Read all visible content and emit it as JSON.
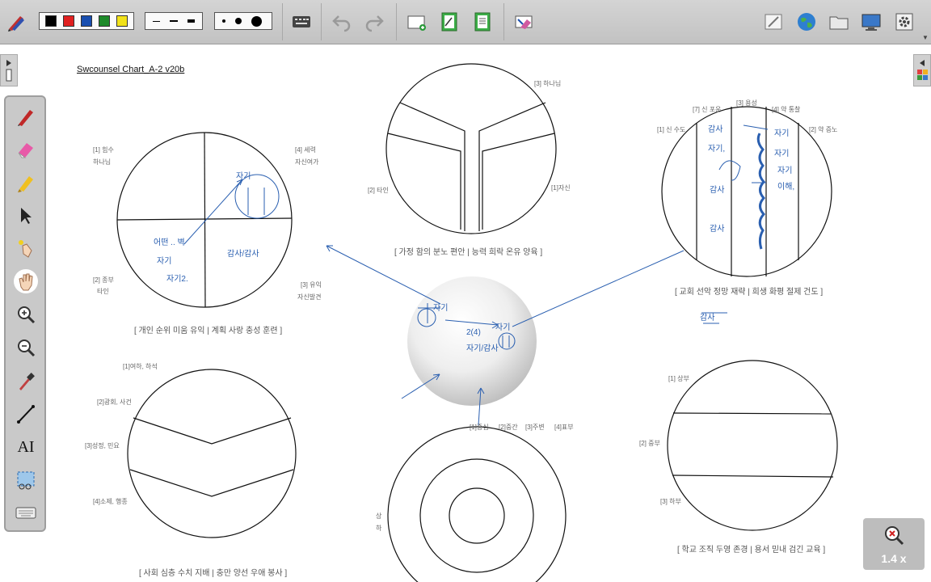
{
  "document": {
    "title": "Swcounsel Chart_A-2 v20b"
  },
  "toolbar": {
    "colors": [
      "#000000",
      "#e02020",
      "#1a4fb0",
      "#1e8a2a",
      "#f2e21a"
    ],
    "icons": [
      "pen-set-icon",
      "keyboard-icon",
      "undo-icon",
      "redo-icon",
      "add-page-icon",
      "page-edit-icon",
      "page-list-icon",
      "eraser-clear-icon",
      "annotate-icon",
      "globe-icon",
      "folder-icon",
      "display-icon",
      "settings-icon"
    ]
  },
  "palette": {
    "tools": [
      "pen-icon",
      "eraser-icon",
      "highlighter-icon",
      "select-arrow-icon",
      "pointer-hand-icon",
      "pan-hand-icon",
      "zoom-in-icon",
      "zoom-out-icon",
      "color-picker-icon",
      "line-tool-icon",
      "text-tool-icon",
      "screen-capture-icon",
      "keyboard-icon"
    ],
    "text_tool_label": "AI"
  },
  "zoom": {
    "level": "1.4 x"
  },
  "diagrams": {
    "quadrant": {
      "labels": [
        "[1] 힘수",
        "하나님",
        "[4] 세력",
        "자신여가",
        "[2] 종부",
        "타인",
        "[3] 유익",
        "자신발견"
      ],
      "caption": "[ 개인 순위 미움 유익 | 계획 사랑 충성 훈련 ]"
    },
    "trisect": {
      "labels": [
        "[3] 하나님",
        "[2] 타인",
        "[1]자신"
      ],
      "caption": "[ 가정 함의 분노 편안 | 능력 희락 온유 양육 ]"
    },
    "church": {
      "labels": [
        "[7] 신 포운",
        "[3] 용성",
        "[4] 약 통찰",
        "[1] 신 수도",
        "[2] 약 증노"
      ],
      "caption": "[ 교회 선악 정망 재략 | 희생 화평 절제 건도 ]"
    },
    "chevron": {
      "labels": [
        "[1]여하, 하석",
        "[2]광회, 사건",
        "[3]성정, 민요",
        "[4]소제, 행종"
      ],
      "caption": "[ 사회 심층 수치 지배 | 충만 양선 우애 봉사 ]"
    },
    "concentric": {
      "labels": [
        "[1]중심",
        "[2]중간",
        "[3]주변",
        "[4]표부",
        "상",
        "하"
      ]
    },
    "bands": {
      "labels": [
        "[1] 상부",
        "[2] 중부",
        "[3] 하부"
      ],
      "caption": "[ 학교 조직 두영 존경 | 용서 믿내 검긴 교육 ]"
    }
  },
  "handwriting": {
    "quadrant": [
      "자기",
      "어떤 .. 벽",
      "자기",
      "자기2.",
      "감사/감사"
    ],
    "center": [
      "자기",
      "2(4)",
      "자기",
      "자기/감사"
    ],
    "church": [
      "감사",
      "자기",
      "자기,",
      "자기",
      "감사",
      "자기",
      "감사",
      "이해,",
      "감사"
    ]
  }
}
